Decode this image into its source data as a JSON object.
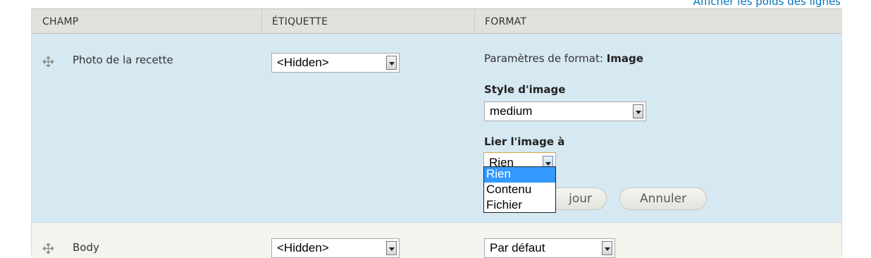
{
  "top_link": "Afficher les poids des lignes",
  "table": {
    "headers": [
      "CHAMP",
      "ÉTIQUETTE",
      "FORMAT"
    ]
  },
  "rows": [
    {
      "field": "Photo de la recette",
      "label_select": "<Hidden>",
      "format_summary_prefix": "Paramètres de format:",
      "format_summary_value": "Image",
      "image_style_label": "Style d'image",
      "image_style_value": "medium",
      "link_label": "Lier l'image à",
      "link_value": "Rien",
      "link_options": [
        "Rien",
        "Contenu",
        "Fichier"
      ],
      "update_button_visible_text": "jour",
      "cancel_button": "Annuler"
    },
    {
      "field": "Body",
      "label_select": "<Hidden>",
      "format_select": "Par défaut"
    }
  ]
}
